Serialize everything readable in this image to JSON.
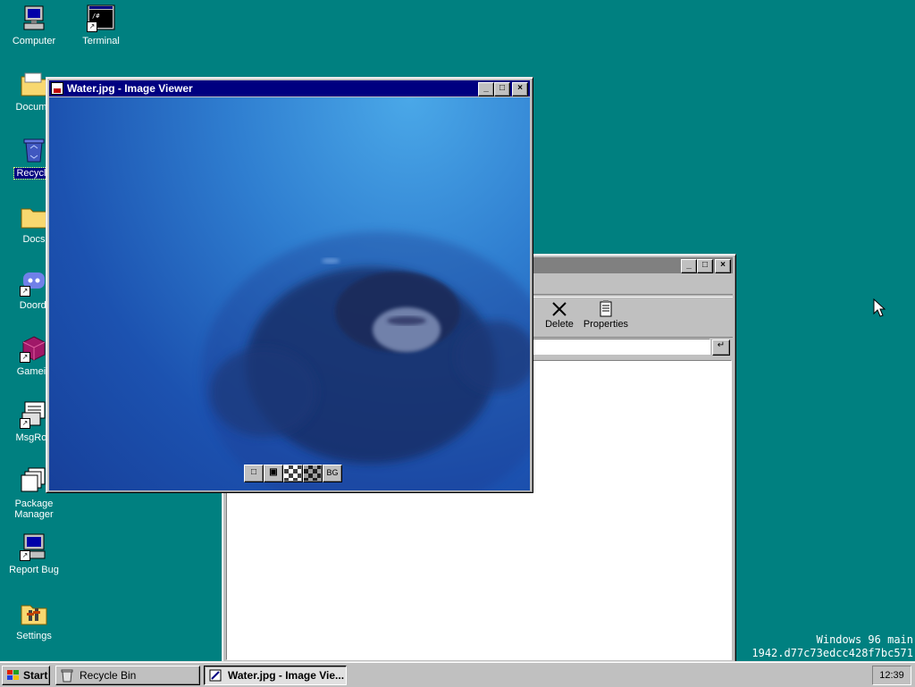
{
  "desktop": {
    "icons": [
      {
        "label": "Computer"
      },
      {
        "label": "Terminal"
      },
      {
        "label": "Docume"
      },
      {
        "label": "Recycle"
      },
      {
        "label": "Docs"
      },
      {
        "label": "Doordi"
      },
      {
        "label": "Gamein"
      },
      {
        "label": "MsgRoo"
      },
      {
        "label": "Package Manager"
      },
      {
        "label": "Report Bug"
      },
      {
        "label": "Settings"
      }
    ],
    "watermark_line1": "Windows 96 main",
    "watermark_line2": "1942.d77c73edcc428f7bc571"
  },
  "explorer": {
    "delete_label": "Delete",
    "properties_label": "Properties",
    "go_glyph": "↵"
  },
  "viewer": {
    "title": "Water.jpg - Image Viewer",
    "bg_label": "BG"
  },
  "taskbar": {
    "start_label": "Start",
    "tasks": [
      {
        "label": "Recycle Bin"
      },
      {
        "label": "Water.jpg - Image Vie..."
      }
    ],
    "clock": "12:39"
  },
  "colors": {
    "desktop": "#008080",
    "title_active": "#000080",
    "title_inactive": "#808080",
    "face": "#c0c0c0"
  }
}
